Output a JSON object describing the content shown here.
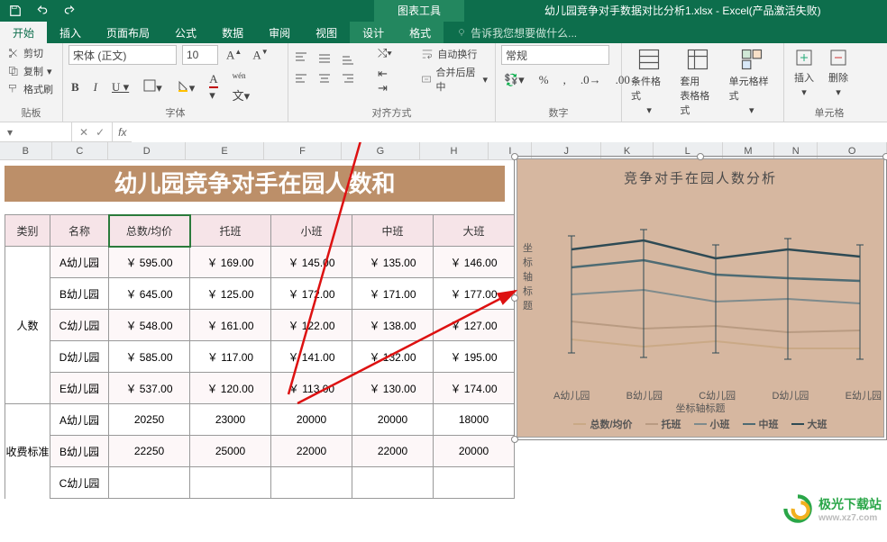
{
  "title": {
    "chart_tools": "图表工具",
    "filename": "幼儿园竞争对手数据对比分析1.xlsx - Excel(产品激活失败)"
  },
  "tabs": {
    "items": [
      "开始",
      "插入",
      "页面布局",
      "公式",
      "数据",
      "审阅",
      "视图",
      "设计",
      "格式"
    ],
    "active": 0,
    "context_start": 7,
    "tellme": {
      "placeholder": "告诉我您想要做什么..."
    }
  },
  "ribbon": {
    "clipboard": {
      "cut": "剪切",
      "copy": "复制",
      "painter": "格式刷",
      "label": "贴板"
    },
    "font": {
      "name": "宋体 (正文)",
      "size": "10",
      "label": "字体"
    },
    "alignment": {
      "wrap": "自动换行",
      "merge": "合并后居中",
      "label": "对齐方式"
    },
    "number": {
      "format": "常规",
      "label": "数字"
    },
    "styles": {
      "cond_format": "条件格式",
      "table_format": "套用\n表格格式",
      "cell_style": "单元格样式"
    },
    "cells": {
      "insert": "插入",
      "delete": "删除",
      "label": "单元格"
    }
  },
  "formula_bar": {
    "namebox": "",
    "cancel": "✕",
    "enter": "✓",
    "fx": "fx"
  },
  "columns": [
    "B",
    "C",
    "D",
    "E",
    "F",
    "G",
    "H",
    "I",
    "J",
    "K",
    "L",
    "M",
    "N",
    "O"
  ],
  "banner": "幼儿园竞争对手在园人数和",
  "table": {
    "headers": {
      "cat": "类别",
      "name": "名称",
      "cols": [
        "总数/均价",
        "托班",
        "小班",
        "中班",
        "大班"
      ]
    },
    "group1_label": "人数",
    "group1": [
      {
        "name": "A幼儿园",
        "vals": [
          "￥ 595.00",
          "￥ 169.00",
          "￥ 145.00",
          "￥ 135.00",
          "￥ 146.00"
        ]
      },
      {
        "name": "B幼儿园",
        "vals": [
          "￥ 645.00",
          "￥ 125.00",
          "￥ 172.00",
          "￥ 171.00",
          "￥ 177.00"
        ]
      },
      {
        "name": "C幼儿园",
        "vals": [
          "￥ 548.00",
          "￥ 161.00",
          "￥ 122.00",
          "￥ 138.00",
          "￥ 127.00"
        ]
      },
      {
        "name": "D幼儿园",
        "vals": [
          "￥ 585.00",
          "￥ 117.00",
          "￥ 141.00",
          "￥ 132.00",
          "￥ 195.00"
        ]
      },
      {
        "name": "E幼儿园",
        "vals": [
          "￥ 537.00",
          "￥ 120.00",
          "￥ 113.00",
          "￥ 130.00",
          "￥ 174.00"
        ]
      }
    ],
    "group2": [
      {
        "name": "A幼儿园",
        "vals": [
          "20250",
          "23000",
          "20000",
          "20000",
          "18000"
        ]
      },
      {
        "name": "B幼儿园",
        "vals": [
          "22250",
          "25000",
          "22000",
          "22000",
          "20000"
        ]
      },
      {
        "name": "C幼儿园",
        "vals": [
          "",
          "",
          "",
          "",
          ""
        ]
      }
    ],
    "group2_label": "收费标准"
  },
  "chart": {
    "title": "竞争对手在园人数分析",
    "y_title": "坐标轴标题",
    "x_title": "坐标轴标题",
    "categories": [
      "A幼儿园",
      "B幼儿园",
      "C幼儿园",
      "D幼儿园",
      "E幼儿园"
    ],
    "legend": [
      "总数/均价",
      "托班",
      "小班",
      "中班",
      "大班"
    ],
    "colors": {
      "s1": "#caa986",
      "s2": "#b99b82",
      "s3": "#7f8b8c",
      "s4": "#4e6b73",
      "s5": "#2e4a54"
    }
  },
  "watermark": {
    "text": "极光下载站",
    "url": "www.xz7.com"
  },
  "chart_data": {
    "type": "line",
    "title": "竞争对手在园人数分析",
    "categories": [
      "A幼儿园",
      "B幼儿园",
      "C幼儿园",
      "D幼儿园",
      "E幼儿园"
    ],
    "series": [
      {
        "name": "总数/均价",
        "values": [
          595,
          645,
          548,
          585,
          537
        ]
      },
      {
        "name": "托班",
        "values": [
          169,
          125,
          161,
          117,
          120
        ]
      },
      {
        "name": "小班",
        "values": [
          145,
          172,
          122,
          141,
          113
        ]
      },
      {
        "name": "中班",
        "values": [
          135,
          171,
          138,
          132,
          130
        ]
      },
      {
        "name": "大班",
        "values": [
          146,
          177,
          127,
          195,
          174
        ]
      }
    ],
    "xlabel": "坐标轴标题",
    "ylabel": "坐标轴标题",
    "ylim": [
      100,
      200
    ]
  }
}
